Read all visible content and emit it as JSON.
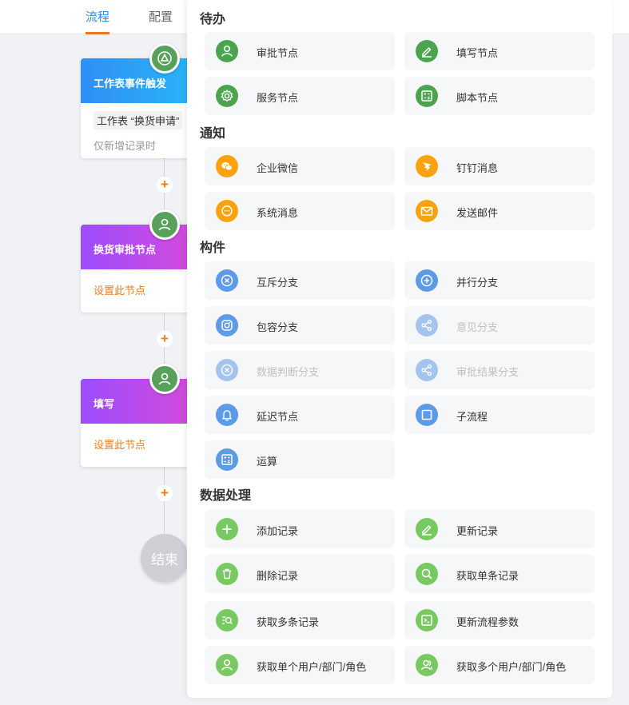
{
  "tabs": [
    {
      "label": "流程"
    },
    {
      "label": "配置"
    }
  ],
  "flow": {
    "trigger": {
      "title": "工作表事件触发",
      "tag": "工作表 “换货申请”",
      "sub": "仅新增记录时"
    },
    "approval": {
      "title": "换货审批节点",
      "action": "设置此节点"
    },
    "fill": {
      "title": "填写",
      "action": "设置此节点"
    },
    "end_label": "结束"
  },
  "panel": {
    "sections": [
      {
        "title": "待办",
        "items": [
          {
            "label": "审批节点",
            "icon": "user-icon",
            "color": "#4ca54e"
          },
          {
            "label": "填写节点",
            "icon": "edit-icon",
            "color": "#4ca54e"
          },
          {
            "label": "服务节点",
            "icon": "gear-icon",
            "color": "#4ca54e"
          },
          {
            "label": "脚本节点",
            "icon": "calculator-icon",
            "color": "#4ca54e"
          }
        ]
      },
      {
        "title": "通知",
        "items": [
          {
            "label": "企业微信",
            "icon": "wechat-icon",
            "color": "#fba30f"
          },
          {
            "label": "钉钉消息",
            "icon": "dingtalk-icon",
            "color": "#fba30f"
          },
          {
            "label": "系统消息",
            "icon": "message-icon",
            "color": "#fba30f"
          },
          {
            "label": "发送邮件",
            "icon": "mail-icon",
            "color": "#fba30f"
          }
        ]
      },
      {
        "title": "构件",
        "items": [
          {
            "label": "互斥分支",
            "icon": "x-circle-icon",
            "color": "#5e9be6"
          },
          {
            "label": "并行分支",
            "icon": "plus-circle-icon",
            "color": "#5e9be6"
          },
          {
            "label": "包容分支",
            "icon": "inclusive-icon",
            "color": "#5e9be6"
          },
          {
            "label": "意见分支",
            "icon": "share-icon",
            "color": "#5e9be6",
            "disabled": true
          },
          {
            "label": "数据判断分支",
            "icon": "x-circle-icon",
            "color": "#5e9be6",
            "disabled": true
          },
          {
            "label": "审批结果分支",
            "icon": "share-icon",
            "color": "#5e9be6",
            "disabled": true
          },
          {
            "label": "延迟节点",
            "icon": "bell-icon",
            "color": "#5e9be6"
          },
          {
            "label": "子流程",
            "icon": "square-icon",
            "color": "#5e9be6"
          },
          {
            "label": "运算",
            "icon": "calculator-icon",
            "color": "#5e9be6"
          }
        ]
      },
      {
        "title": "数据处理",
        "items": [
          {
            "label": "添加记录",
            "icon": "plus-icon",
            "color": "#78c962"
          },
          {
            "label": "更新记录",
            "icon": "edit-icon",
            "color": "#78c962"
          },
          {
            "label": "删除记录",
            "icon": "trash-icon",
            "color": "#78c962"
          },
          {
            "label": "获取单条记录",
            "icon": "search-icon",
            "color": "#78c962"
          },
          {
            "label": "获取多条记录",
            "icon": "search-list-icon",
            "color": "#78c962"
          },
          {
            "label": "更新流程参数",
            "icon": "terminal-icon",
            "color": "#78c962"
          },
          {
            "label": "获取单个用户/部门/角色",
            "icon": "user-icon",
            "color": "#78c962"
          },
          {
            "label": "获取多个用户/部门/角色",
            "icon": "users-icon",
            "color": "#78c962"
          }
        ]
      }
    ]
  }
}
